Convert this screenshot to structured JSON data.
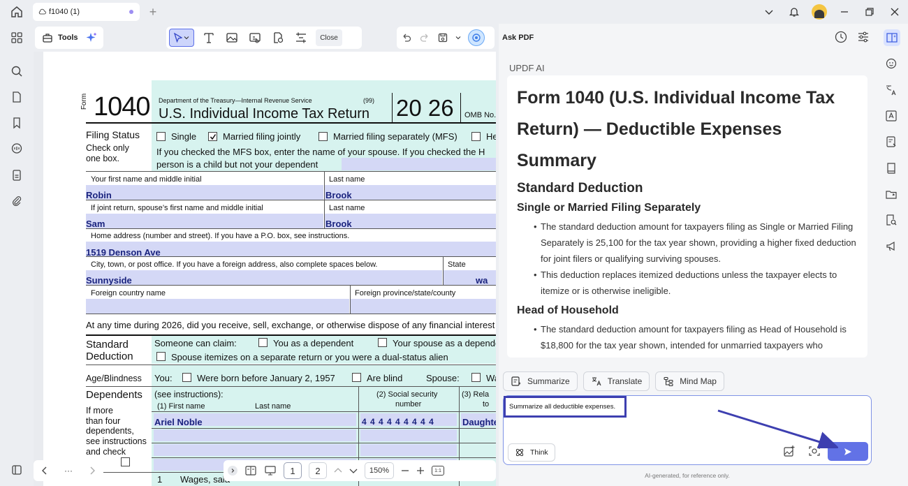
{
  "titlebar": {
    "tab_title": "f1040 (1)",
    "new_tab": "+"
  },
  "toolbar": {
    "tools_label": "Tools",
    "close_label": "Close"
  },
  "form": {
    "form_word": "Form",
    "form_number": "1040",
    "department": "Department of the Treasury—Internal Revenue Service",
    "code": "(99)",
    "title": "U.S. Individual Income Tax Return",
    "year": "20 26",
    "omb": "OMB No.",
    "filing_status_label": "Filing Status",
    "check_only": "Check only",
    "one_box": "one box.",
    "opt_single": "Single",
    "opt_mfj": "Married filing jointly",
    "opt_mfs": "Married filing separately (MFS)",
    "opt_he": "He",
    "mfs_note": "If you checked  the MFS  box, enter the name of your spouse.  If you checked   the H",
    "mfs_note2": "person is a child but not your dependent",
    "first_name_label": "Your first name and middle initial",
    "last_name_label": "Last name",
    "first_name": "Robin",
    "last_name": "Brook",
    "spouse_label": "If joint return, spouse’s first name and middle initial",
    "spouse_last_label": "Last name",
    "spouse_first": "Sam",
    "spouse_last": "Brook",
    "address_label": "Home address (number and street). If you have a P.O. box, see instructions.",
    "address": "1519 Denson Ave",
    "city_label": "City, town, or post office. If you have a foreign address, also complete spaces below.",
    "state_label": "State",
    "city": "Sunnyside",
    "state": "wa",
    "foreign_country_label": "Foreign country name",
    "foreign_province_label": "Foreign province/state/county",
    "digital_assets": "At any time during 2026, did you receive, sell, exchange, or otherwise dispose of any financial interest in a",
    "std_ded_1": "Standard",
    "std_ded_2": "Deduction",
    "someone_claim": "Someone can claim:",
    "you_dependent": "You as a dependent",
    "spouse_dependent": "Your spouse as a depende",
    "spouse_itemizes": "Spouse itemizes on a separate return or you were a dual-status alien",
    "age_blind": "Age/Blindness",
    "you": "You:",
    "born_before": "Were born before January 2, 1957",
    "are_blind": "Are blind",
    "spouse": "Spouse:",
    "wa_cut": "Wa",
    "dependents": "Dependents",
    "see_instr": "(see instructions):",
    "if_more": "If more",
    "than_four": "than four",
    "dependents_l": "dependents,",
    "see_instructions": "see instructions",
    "and_check": "and check",
    "col_first": "(1) First name",
    "col_last": "Last name",
    "col_ssn": "(2) Social security",
    "col_ssn2": "number",
    "col_rel": "(3) Rela",
    "col_rel2": "to",
    "dep_name": "Ariel Noble",
    "dep_ssn": "4 4 4  4 4  4 4 4 4",
    "dep_rel": "Daughte",
    "line1_num": "1",
    "line1_text": "Wages, sala"
  },
  "pagenav": {
    "more": "···"
  },
  "viewbar": {
    "page1": "1",
    "page2": "2",
    "zoom": "150%",
    "fit": "1:1"
  },
  "askpdf": {
    "title": "Ask PDF",
    "ai_label": "UPDF AI",
    "answer": {
      "heading": "Form 1040 (U.S. Individual Income Tax Return) — Deductible Expenses Summary",
      "section": "Standard Deduction",
      "sub1": "Single or Married Filing Separately",
      "b1": "The standard deduction amount for taxpayers filing as Single or Married Filing Separately is 25,100 for the tax year shown, providing a higher fixed deduction for joint filers or qualifying surviving spouses.",
      "b2": "This deduction replaces itemized deductions unless the taxpayer elects to itemize or is otherwise ineligible.",
      "sub2": "Head of Household",
      "b3": "The standard deduction amount for taxpayers filing as Head of Household is $18,800 for the tax year shown, intended for unmarried taxpayers who maintain a household for a qualifying"
    },
    "summarize": "Summarize",
    "translate": "Translate",
    "mindmap": "Mind Map",
    "prompt": "Summarize all deductible expenses.",
    "think": "Think",
    "disclaimer": "AI-generated, for reference only."
  }
}
